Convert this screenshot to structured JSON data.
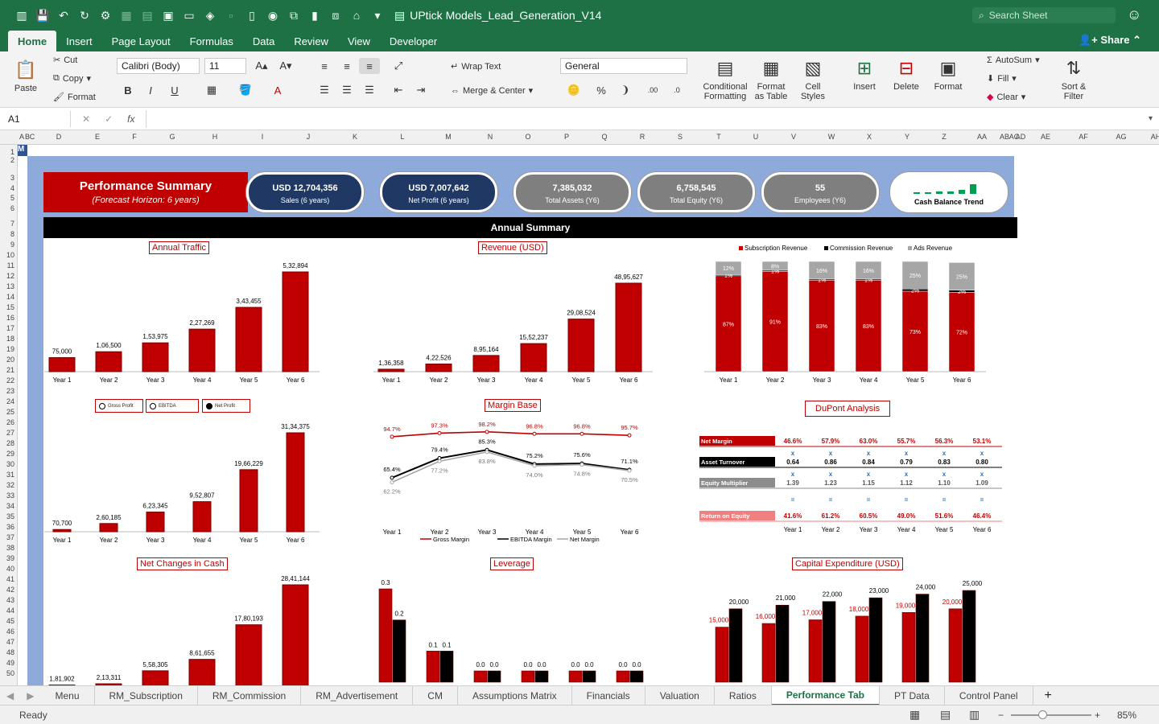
{
  "window": {
    "title": "UPtick Models_Lead_Generation_V14",
    "search_placeholder": "Search Sheet",
    "share": "Share"
  },
  "ribbon_tabs": [
    "Home",
    "Insert",
    "Page Layout",
    "Formulas",
    "Data",
    "Review",
    "View",
    "Developer"
  ],
  "ribbon": {
    "paste": "Paste",
    "cut": "Cut",
    "copy": "Copy",
    "format": "Format",
    "font": "Calibri (Body)",
    "size": "11",
    "wrap": "Wrap Text",
    "merge": "Merge & Center",
    "numfmt": "General",
    "cond": [
      "Conditional",
      "Formatting"
    ],
    "fmttable": [
      "Format",
      "as Table"
    ],
    "cellstyles": [
      "Cell",
      "Styles"
    ],
    "insert": "Insert",
    "delete": "Delete",
    "formatbtn": "Format",
    "autosum": "AutoSum",
    "fill": "Fill",
    "clear": "Clear",
    "sort": [
      "Sort &",
      "Filter"
    ]
  },
  "formula": {
    "cell": "A1",
    "fx": "fx"
  },
  "columns": [
    "A",
    "B",
    "C",
    "D",
    "E",
    "F",
    "G",
    "H",
    "I",
    "J",
    "K",
    "L",
    "M",
    "N",
    "O",
    "P",
    "Q",
    "R",
    "S",
    "T",
    "U",
    "V",
    "W",
    "X",
    "Y",
    "Z",
    "AA",
    "AB",
    "AC",
    "AD",
    "AE",
    "AF",
    "AG",
    "AH"
  ],
  "rows": [
    "1",
    "2",
    "3",
    "4",
    "5",
    "6",
    "7",
    "8",
    "9",
    "10",
    "11",
    "12",
    "13",
    "14",
    "15",
    "16",
    "17",
    "18",
    "19",
    "20",
    "21",
    "22",
    "23",
    "24",
    "25",
    "26",
    "27",
    "28",
    "29",
    "30",
    "31",
    "32",
    "33",
    "34",
    "35",
    "36",
    "37",
    "38",
    "39",
    "40",
    "41",
    "42",
    "43",
    "44",
    "45",
    "46",
    "47",
    "48",
    "49",
    "50"
  ],
  "dashboard": {
    "perf_title": "Performance Summary",
    "perf_sub": "(Forecast Horizon: 6 years)",
    "kpis": [
      {
        "value": "USD 12,704,356",
        "label": "Sales (6 years)"
      },
      {
        "value": "USD 7,007,642",
        "label": "Net Profit (6 years)"
      },
      {
        "value": "7,385,032",
        "label": "Total Assets (Y6)"
      },
      {
        "value": "6,758,545",
        "label": "Total Equity (Y6)"
      },
      {
        "value": "55",
        "label": "Employees (Y6)"
      },
      {
        "value": "",
        "label": "Cash Balance Trend"
      }
    ],
    "annual": "Annual Summary",
    "colors": {
      "red": "#c00000",
      "black": "#000000",
      "grey": "#a6a6a6",
      "blue": "#1f3864"
    }
  },
  "chart_data": [
    {
      "type": "bar",
      "title": "Annual Traffic",
      "categories": [
        "Year 1",
        "Year 2",
        "Year 3",
        "Year 4",
        "Year 5",
        "Year 6"
      ],
      "values": [
        75000,
        106500,
        153975,
        227269,
        343455,
        532894
      ],
      "labels": [
        "75,000",
        "1,06,500",
        "1,53,975",
        "2,27,269",
        "3,43,455",
        "5,32,894"
      ]
    },
    {
      "type": "bar",
      "title": "Revenue (USD)",
      "categories": [
        "Year 1",
        "Year 2",
        "Year 3",
        "Year 4",
        "Year 5",
        "Year 6"
      ],
      "values": [
        136358,
        422526,
        895164,
        1552237,
        2908524,
        4895627
      ],
      "labels": [
        "1,36,358",
        "4,22,526",
        "8,95,164",
        "15,52,237",
        "29,08,524",
        "48,95,627"
      ]
    },
    {
      "type": "bar",
      "stacked": true,
      "title": "",
      "categories": [
        "Year 1",
        "Year 2",
        "Year 3",
        "Year 4",
        "Year 5",
        "Year 6"
      ],
      "series": [
        {
          "name": "Subscription Revenue",
          "values": [
            87,
            91,
            83,
            83,
            73,
            72
          ],
          "labels": [
            "87%",
            "91%",
            "83%",
            "83%",
            "73%",
            "72%"
          ]
        },
        {
          "name": "Commission Revenue",
          "values": [
            1,
            1,
            1,
            1,
            2,
            2
          ],
          "labels": [
            "1%",
            "1%",
            "1%",
            "1%",
            "2%",
            "2%"
          ]
        },
        {
          "name": "Ads Revenue",
          "values": [
            12,
            8,
            16,
            16,
            25,
            25
          ],
          "labels": [
            "12%",
            "8%",
            "16%",
            "16%",
            "25%",
            "25%"
          ]
        }
      ]
    },
    {
      "type": "bar",
      "title": "",
      "options": [
        "Gross Profit",
        "EBITDA",
        "Net Profit"
      ],
      "categories": [
        "Year 1",
        "Year 2",
        "Year 3",
        "Year 4",
        "Year 5",
        "Year 6"
      ],
      "values": [
        70700,
        260185,
        623345,
        952807,
        1966229,
        3134375
      ],
      "labels": [
        "70,700",
        "2,60,185",
        "6,23,345",
        "9,52,807",
        "19,66,229",
        "31,34,375"
      ]
    },
    {
      "type": "line",
      "title": "Margin Base",
      "categories": [
        "Year 1",
        "Year 2",
        "Year 3",
        "Year 4",
        "Year 5",
        "Year 6"
      ],
      "series": [
        {
          "name": "Gross Margin",
          "values": [
            94.7,
            97.3,
            98.2,
            96.8,
            96.8,
            95.7
          ],
          "labels": [
            "94.7%",
            "97.3%",
            "98.2%",
            "96.8%",
            "96.8%",
            "95.7%"
          ]
        },
        {
          "name": "EBITDA Margin",
          "values": [
            65.4,
            79.4,
            85.3,
            75.2,
            75.6,
            71.1
          ],
          "labels": [
            "65.4%",
            "79.4%",
            "85.3%",
            "75.2%",
            "75.6%",
            "71.1%"
          ]
        },
        {
          "name": "Net Margin",
          "values": [
            62.2,
            77.2,
            83.8,
            74.0,
            74.8,
            70.5
          ],
          "labels": [
            "62.2%",
            "77.2%",
            "83.8%",
            "74.0%",
            "74.8%",
            "70.5%"
          ]
        }
      ]
    },
    {
      "type": "table",
      "title": "DuPont Analysis",
      "categories": [
        "Year 1",
        "Year 2",
        "Year 3",
        "Year 4",
        "Year 5",
        "Year 6"
      ],
      "rows": [
        {
          "name": "Net Margin",
          "values": [
            "46.6%",
            "57.9%",
            "63.0%",
            "55.7%",
            "56.3%",
            "53.1%"
          ]
        },
        {
          "name": "Asset Turnover",
          "values": [
            "0.64",
            "0.86",
            "0.84",
            "0.79",
            "0.83",
            "0.80"
          ]
        },
        {
          "name": "Equity Multiplier",
          "values": [
            "1.39",
            "1.23",
            "1.15",
            "1.12",
            "1.10",
            "1.09"
          ]
        },
        {
          "name": "Return on Equity",
          "values": [
            "41.6%",
            "61.2%",
            "60.5%",
            "49.0%",
            "51.6%",
            "46.4%"
          ]
        }
      ],
      "ops": [
        "x",
        "x",
        "="
      ]
    },
    {
      "type": "bar",
      "title": "Net Changes in Cash",
      "categories": [
        "Year 1",
        "Year 2",
        "Year 3",
        "Year 4",
        "Year 5",
        "Year 6"
      ],
      "values": [
        181902,
        213311,
        558305,
        861655,
        1780193,
        2841144
      ],
      "labels": [
        "1,81,902",
        "2,13,311",
        "5,58,305",
        "8,61,655",
        "17,80,193",
        "28,41,144"
      ]
    },
    {
      "type": "bar",
      "title": "Leverage",
      "categories": [
        "Year 1",
        "Year 2",
        "Year 3",
        "Year 4",
        "Year 5",
        "Year 6"
      ],
      "series": [
        {
          "name": "",
          "values": [
            0.3,
            0.1,
            0.0,
            0.0,
            0.0,
            0.0
          ],
          "labels": [
            "0.3",
            "0.1",
            "0.0",
            "0.0",
            "0.0",
            "0.0"
          ]
        },
        {
          "name": "",
          "values": [
            0.2,
            0.1,
            0.0,
            0.0,
            0.0,
            0.0
          ],
          "labels": [
            "0.2",
            "0.1",
            "0.0",
            "0.0",
            "0.0",
            "0.0"
          ]
        }
      ]
    },
    {
      "type": "bar",
      "title": "Capital Expenditure (USD)",
      "categories": [
        "Year 1",
        "Year 2",
        "Year 3",
        "Year 4",
        "Year 5",
        "Year 6"
      ],
      "series": [
        {
          "name": "",
          "values": [
            15000,
            16000,
            17000,
            18000,
            19000,
            20000
          ],
          "labels": [
            "15,000",
            "16,000",
            "17,000",
            "18,000",
            "19,000",
            "20,000"
          ]
        },
        {
          "name": "",
          "values": [
            20000,
            21000,
            22000,
            23000,
            24000,
            25000
          ],
          "labels": [
            "20,000",
            "21,000",
            "22,000",
            "23,000",
            "24,000",
            "25,000"
          ]
        }
      ]
    }
  ],
  "sheet_tabs": [
    "Menu",
    "RM_Subscription",
    "RM_Commission",
    "RM_Advertisement",
    "CM",
    "Assumptions Matrix",
    "Financials",
    "Valuation",
    "Ratios",
    "Performance Tab",
    "PT Data",
    "Control Panel"
  ],
  "active_tab": "Performance Tab",
  "status": {
    "ready": "Ready",
    "zoom": "85%"
  }
}
